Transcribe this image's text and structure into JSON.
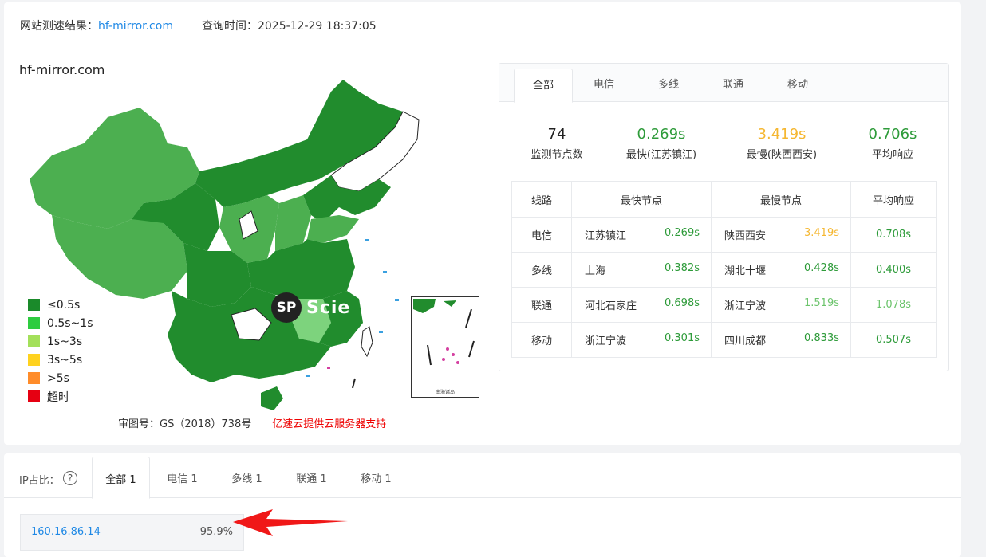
{
  "header": {
    "result_label": "网站测速结果：",
    "site": "hf-mirror.com",
    "time_label": "查询时间：",
    "time_value": "2025-12-29 18:37:05"
  },
  "map": {
    "title": "hf-mirror.com",
    "legend": [
      {
        "label": "≤0.5s",
        "color": "#1a8a2a"
      },
      {
        "label": "0.5s~1s",
        "color": "#2ecc40"
      },
      {
        "label": "1s~3s",
        "color": "#a3e05a"
      },
      {
        "label": "3s~5s",
        "color": "#ffd21f"
      },
      {
        "label": ">5s",
        "color": "#ff8c2a"
      },
      {
        "label": "超时",
        "color": "#e60012"
      }
    ],
    "footer_text": "审图号：GS（2018）738号",
    "sponsor": "亿速云提供云服务器支持",
    "inset_label": "南海诸岛",
    "watermark_badge": "SP",
    "watermark_text": "Scie"
  },
  "stats": {
    "tabs": [
      "全部",
      "电信",
      "多线",
      "联通",
      "移动"
    ],
    "active_tab": "全部",
    "summary": [
      {
        "value": "74",
        "label": "监测节点数",
        "color": "#222222"
      },
      {
        "value": "0.269s",
        "label": "最快(江苏镇江)",
        "color": "#2e9b3a"
      },
      {
        "value": "3.419s",
        "label": "最慢(陕西西安)",
        "color": "#f5b731"
      },
      {
        "value": "0.706s",
        "label": "平均响应",
        "color": "#2e9b3a"
      }
    ],
    "table": {
      "headers": [
        "线路",
        "最快节点",
        "最慢节点",
        "平均响应"
      ],
      "rows": [
        {
          "line": "电信",
          "fast_node": "江苏镇江",
          "fast_time": "0.269s",
          "fast_color": "#2e9b3a",
          "slow_node": "陕西西安",
          "slow_time": "3.419s",
          "slow_color": "#f5b731",
          "avg": "0.708s",
          "avg_color": "#2e9b3a"
        },
        {
          "line": "多线",
          "fast_node": "上海",
          "fast_time": "0.382s",
          "fast_color": "#2e9b3a",
          "slow_node": "湖北十堰",
          "slow_time": "0.428s",
          "slow_color": "#2e9b3a",
          "avg": "0.400s",
          "avg_color": "#2e9b3a"
        },
        {
          "line": "联通",
          "fast_node": "河北石家庄",
          "fast_time": "0.698s",
          "fast_color": "#2e9b3a",
          "slow_node": "浙江宁波",
          "slow_time": "1.519s",
          "slow_color": "#6cc46c",
          "avg": "1.078s",
          "avg_color": "#6cc46c"
        },
        {
          "line": "移动",
          "fast_node": "浙江宁波",
          "fast_time": "0.301s",
          "fast_color": "#2e9b3a",
          "slow_node": "四川成都",
          "slow_time": "0.833s",
          "slow_color": "#2e9b3a",
          "avg": "0.507s",
          "avg_color": "#2e9b3a"
        }
      ]
    }
  },
  "ip": {
    "label": "IP占比：",
    "help_icon": "?",
    "tabs": [
      "全部 1",
      "电信 1",
      "多线 1",
      "联通 1",
      "移动 1"
    ],
    "active_tab": "全部 1",
    "rows": [
      {
        "address": "160.16.86.14",
        "percent": "95.9%"
      }
    ]
  }
}
